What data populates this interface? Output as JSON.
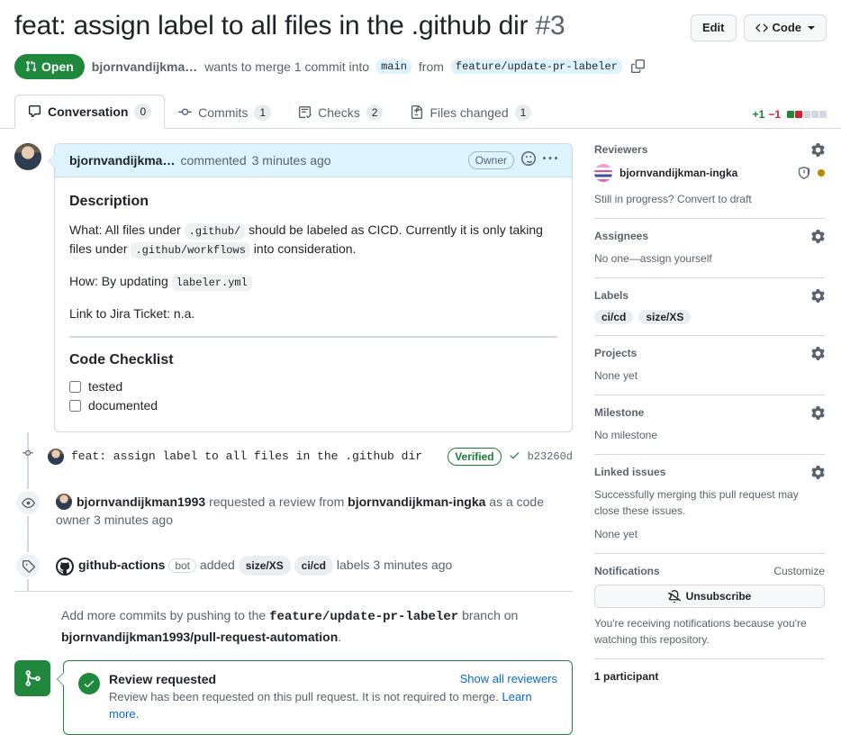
{
  "header": {
    "title": "feat: assign label to all files in the .github dir",
    "number": "#3",
    "edit_label": "Edit",
    "code_label": "Code",
    "state": "Open",
    "author": "bjornvandijkma…",
    "merge_text_1": "wants to merge 1 commit into",
    "base_branch": "main",
    "merge_text_2": "from",
    "head_branch": "feature/update-pr-labeler"
  },
  "tabs": [
    {
      "label": "Conversation",
      "count": "0",
      "icon": "comment-icon",
      "active": true
    },
    {
      "label": "Commits",
      "count": "1",
      "icon": "commit-icon",
      "active": false
    },
    {
      "label": "Checks",
      "count": "2",
      "icon": "checklist-icon",
      "active": false
    },
    {
      "label": "Files changed",
      "count": "1",
      "icon": "file-diff-icon",
      "active": false
    }
  ],
  "diffstat": {
    "additions": "+1",
    "deletions": "−1",
    "blocks": [
      "g",
      "r",
      "n",
      "n",
      "n"
    ]
  },
  "comment": {
    "author": "bjornvandijkma…",
    "action": "commented",
    "time": "3 minutes ago",
    "badge": "Owner",
    "heading": "Description",
    "what_prefix": "What: All files under",
    "what_code_1": ".github/",
    "what_mid": "should be labeled as CICD. Currently it is only taking files under",
    "what_code_2": ".github/workflows",
    "what_suffix": "into consideration.",
    "how_prefix": "How: By updating",
    "how_code": "labeler.yml",
    "jira": "Link to Jira Ticket: n.a.",
    "checklist_heading": "Code Checklist",
    "checklist": [
      {
        "label": "tested",
        "checked": false
      },
      {
        "label": "documented",
        "checked": false
      }
    ]
  },
  "timeline": {
    "commit": {
      "message": "feat: assign label to all files in the .github dir",
      "verified": "Verified",
      "sha": "b23260d"
    },
    "review_request": {
      "actor": "bjornvandijkman1993",
      "text_1": "requested a review from",
      "reviewer": "bjornvandijkman-ingka",
      "text_2": "as a code owner",
      "time": "3 minutes ago"
    },
    "labeled": {
      "actor": "github-actions",
      "bot": "bot",
      "text_1": "added",
      "labels": [
        "size/XS",
        "ci/cd"
      ],
      "text_2": "labels",
      "time": "3 minutes ago"
    }
  },
  "push_note": {
    "prefix": "Add more commits by pushing to the",
    "branch": "feature/update-pr-labeler",
    "mid": "branch on",
    "repo": "bjornvandijkman1993/pull-request-automation",
    "suffix": "."
  },
  "merge_status": {
    "title": "Review requested",
    "description": "Review has been requested on this pull request. It is not required to merge.",
    "learn_more": "Learn more.",
    "show_all": "Show all reviewers"
  },
  "sidebar": {
    "reviewers": {
      "title": "Reviewers",
      "name": "bjornvandijkman-ingka",
      "note": "Still in progress? Convert to draft"
    },
    "assignees": {
      "title": "Assignees",
      "value": "No one—assign yourself"
    },
    "labels": {
      "title": "Labels",
      "items": [
        "ci/cd",
        "size/XS"
      ]
    },
    "projects": {
      "title": "Projects",
      "value": "None yet"
    },
    "milestone": {
      "title": "Milestone",
      "value": "No milestone"
    },
    "linked_issues": {
      "title": "Linked issues",
      "description": "Successfully merging this pull request may close these issues.",
      "value": "None yet"
    },
    "notifications": {
      "title": "Notifications",
      "customize": "Customize",
      "button": "Unsubscribe",
      "note": "You're receiving notifications because you're watching this repository."
    },
    "participants": "1 participant"
  },
  "colors": {
    "open_green": "#1f883d",
    "link_blue": "#0969da",
    "comment_header": "#ddf4ff",
    "add_green": "#1a7f37",
    "del_red": "#cf222e",
    "amber": "#bf8700"
  }
}
